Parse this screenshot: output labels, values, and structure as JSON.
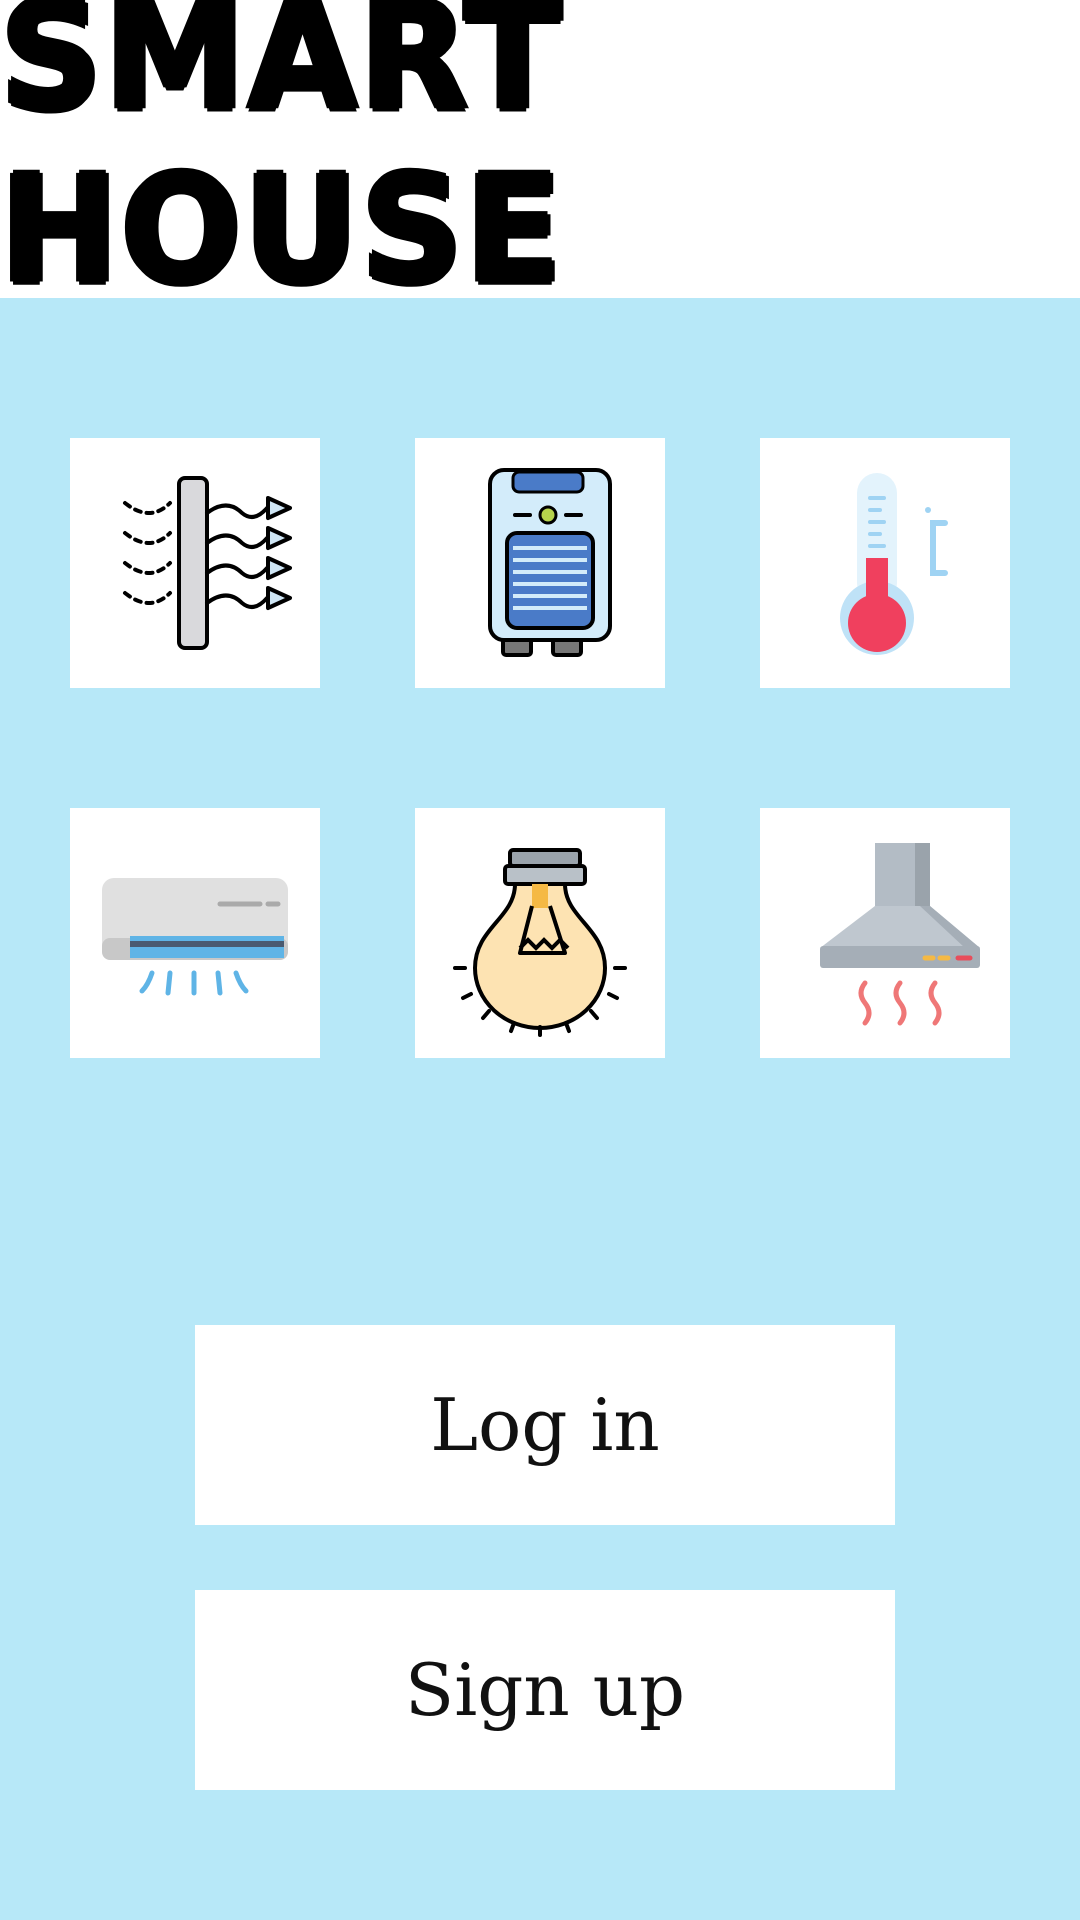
{
  "header": {
    "title": "SMART HOUSE"
  },
  "devices": [
    {
      "icon": "air-filter-icon"
    },
    {
      "icon": "air-purifier-icon"
    },
    {
      "icon": "thermometer-icon"
    },
    {
      "icon": "air-conditioner-icon"
    },
    {
      "icon": "light-bulb-icon"
    },
    {
      "icon": "cooker-hood-icon"
    }
  ],
  "auth": {
    "login_label": "Log in",
    "signup_label": "Sign up"
  },
  "colors": {
    "background": "#b7e8f8",
    "tile": "#ffffff",
    "button": "#ffffff",
    "text": "#000000"
  }
}
